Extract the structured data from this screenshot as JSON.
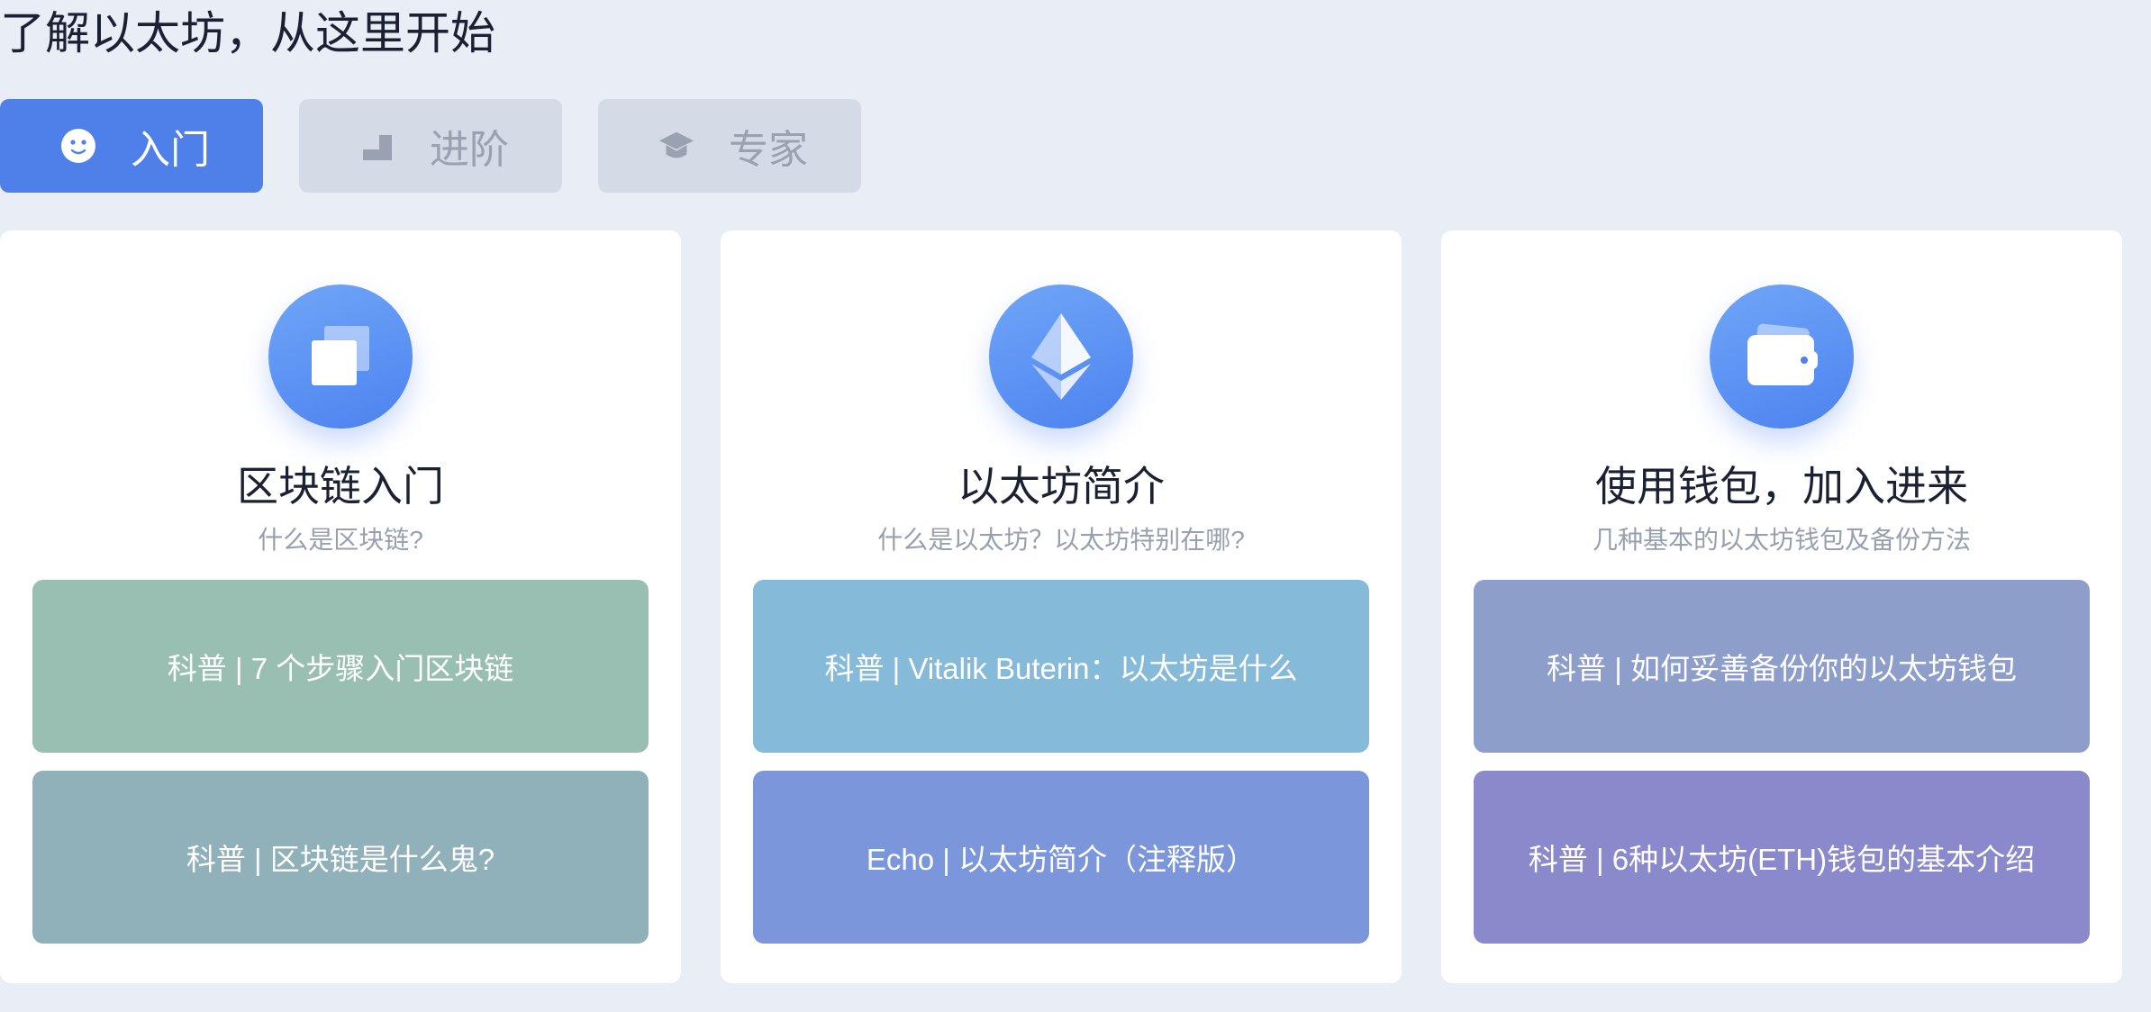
{
  "page": {
    "title": "了解以太坊，从这里开始"
  },
  "tabs": [
    {
      "label": "入门",
      "icon": "smiley-icon",
      "active": true
    },
    {
      "label": "进阶",
      "icon": "stairs-icon",
      "active": false
    },
    {
      "label": "专家",
      "icon": "graduation-cap-icon",
      "active": false
    }
  ],
  "cards": [
    {
      "icon": "layers-icon",
      "title": "区块链入门",
      "subtitle": "什么是区块链?",
      "links": [
        {
          "label": "科普 | 7 个步骤入门区块链",
          "color": "#99bfb2"
        },
        {
          "label": "科普 | 区块链是什么鬼?",
          "color": "#90b0ba"
        }
      ]
    },
    {
      "icon": "ethereum-icon",
      "title": "以太坊简介",
      "subtitle": "什么是以太坊？以太坊特别在哪?",
      "links": [
        {
          "label": "科普 | Vitalik Buterin：以太坊是什么",
          "color": "#86bad9"
        },
        {
          "label": "Echo | 以太坊简介（注释版）",
          "color": "#7b96da"
        }
      ]
    },
    {
      "icon": "wallet-icon",
      "title": "使用钱包，加入进来",
      "subtitle": "几种基本的以太坊钱包及备份方法",
      "links": [
        {
          "label": "科普 | 如何妥善备份你的以太坊钱包",
          "color": "#8e9ecb"
        },
        {
          "label": "科普 | 6种以太坊(ETH)钱包的基本介绍",
          "color": "#8a89cb"
        }
      ]
    }
  ],
  "colors": {
    "background": "#e9edf5",
    "accent": "#4f7fe9",
    "tab_inactive": "#d4dae6"
  }
}
